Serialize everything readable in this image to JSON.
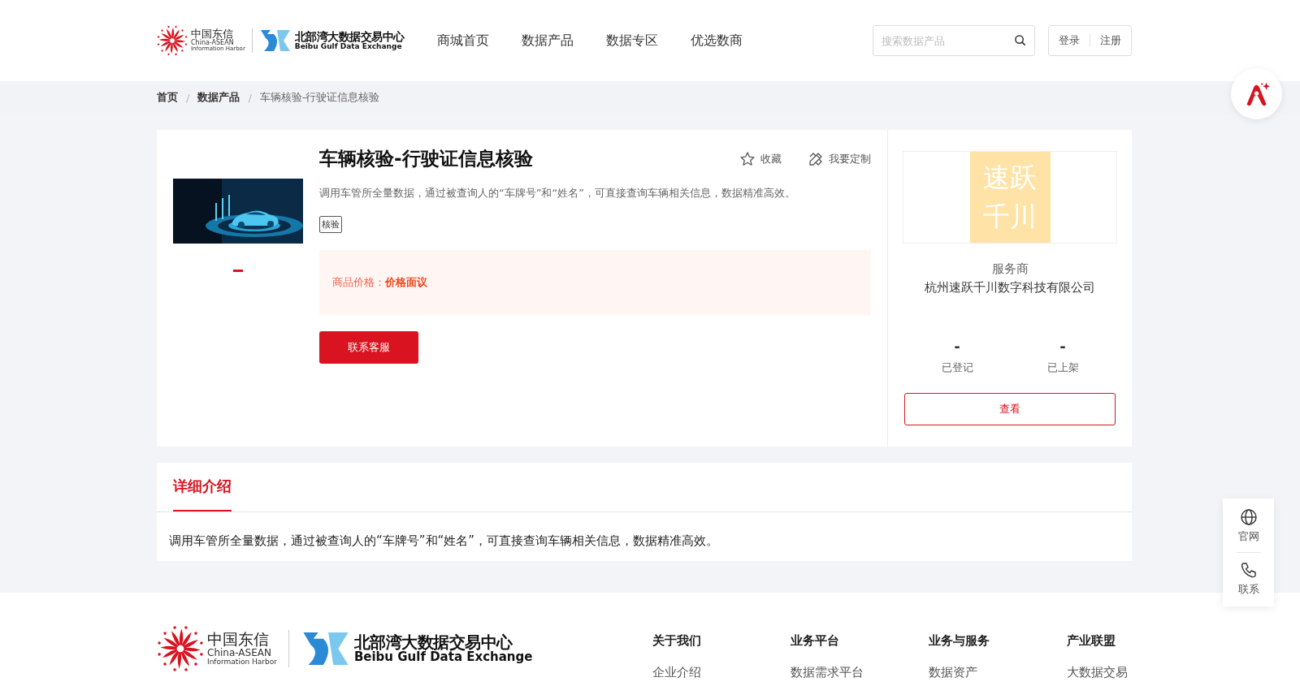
{
  "header": {
    "logo": {
      "cn": "中国东信",
      "en1": "China-ASEAN",
      "en2": "Information Harbor",
      "title_cn": "北部湾大数据交易中心",
      "title_en": "Beibu Gulf Data Exchange"
    },
    "nav": [
      {
        "label": "商城首页",
        "selected": false
      },
      {
        "label": "数据产品",
        "selected": false
      },
      {
        "label": "数据专区",
        "selected": false
      },
      {
        "label": "优选数商",
        "selected": false
      }
    ],
    "search": {
      "placeholder": "搜索数据产品"
    },
    "auth": [
      "登录",
      "注册"
    ]
  },
  "breadcrumb": [
    {
      "label": "首页",
      "current": false
    },
    {
      "separator": "/",
      "label": "数据产品",
      "current": false
    },
    {
      "separator": "/",
      "label": "车辆核验-行驶证信息核验",
      "current": true
    }
  ],
  "product": {
    "title": "车辆核验-行驶证信息核验",
    "actions": [
      {
        "kind": "star",
        "label": "收藏"
      },
      {
        "kind": "custom",
        "label": "我要定制"
      }
    ],
    "description": "调用车管所全量数据，通过被查询人的“车牌号”和“姓名”，可直接查询车辆相关信息，数据精准高效。",
    "tags": [
      "核验"
    ],
    "price_label": "商品价格：",
    "price_value": "价格面议",
    "contact_button": "联系客服"
  },
  "provider": {
    "logo_lines": [
      "速跃",
      "千川"
    ],
    "role": "服务商",
    "name": "杭州速跃千川数字科技有限公司",
    "stats": [
      {
        "value": "-",
        "label": "已登记"
      },
      {
        "value": "-",
        "label": "已上架"
      }
    ],
    "view_button": "查看"
  },
  "detail": {
    "tabs": [
      {
        "label": "详细介绍",
        "selected": true
      }
    ],
    "text": "调用车管所全量数据，通过被查询人的“车牌号”和“姓名”，可直接查询车辆相关信息，数据精准高效。"
  },
  "side_tools": [
    {
      "kind": "globe",
      "label": "官网"
    },
    {
      "kind": "phone",
      "label": "联系"
    }
  ],
  "footer": {
    "logo": {
      "cn": "中国东信",
      "en1": "China-ASEAN",
      "en2": "Information Harbor",
      "title_cn": "北部湾大数据交易中心",
      "title_en": "Beibu Gulf Data Exchange"
    },
    "columns": [
      {
        "title": "关于我们",
        "links": [
          "企业介绍"
        ]
      },
      {
        "title": "业务平台",
        "links": [
          "数据需求平台"
        ]
      },
      {
        "title": "业务与服务",
        "links": [
          "数据资产"
        ]
      },
      {
        "title": "产业联盟",
        "links": [
          "大数据交易"
        ]
      }
    ]
  }
}
